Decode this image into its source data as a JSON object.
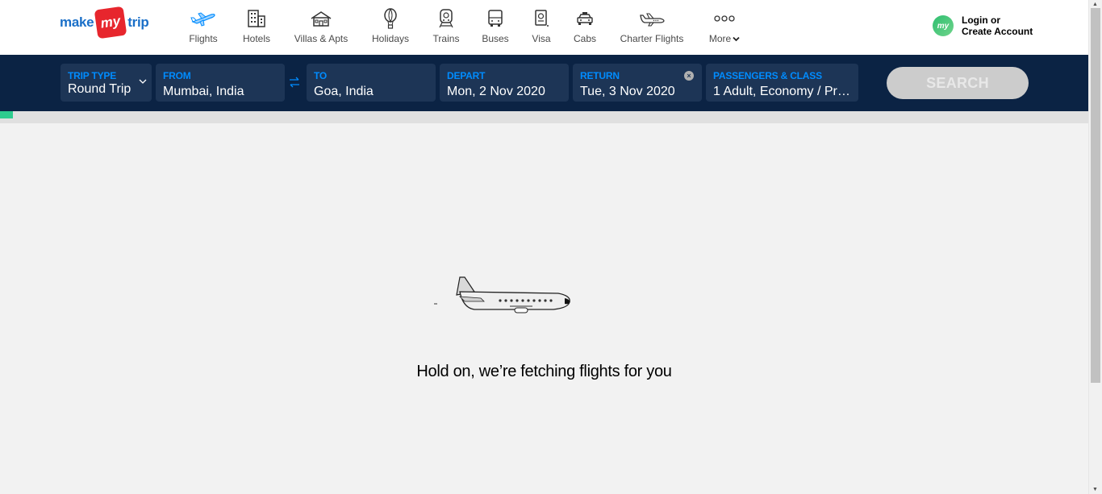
{
  "brand": {
    "make": "make",
    "my": "my",
    "trip": "trip"
  },
  "nav": [
    {
      "label": "Flights",
      "icon": "flight-icon"
    },
    {
      "label": "Hotels",
      "icon": "hotel-icon"
    },
    {
      "label": "Villas & Apts",
      "icon": "villa-icon"
    },
    {
      "label": "Holidays",
      "icon": "holiday-balloon-icon"
    },
    {
      "label": "Trains",
      "icon": "train-icon"
    },
    {
      "label": "Buses",
      "icon": "bus-icon"
    },
    {
      "label": "Visa",
      "icon": "visa-icon"
    },
    {
      "label": "Cabs",
      "icon": "cab-icon"
    },
    {
      "label": "Charter Flights",
      "icon": "charter-plane-icon"
    },
    {
      "label": "More",
      "icon": "more-dots-icon"
    }
  ],
  "account": {
    "avatar": "my",
    "line1": "Login or",
    "line2": "Create Account"
  },
  "search": {
    "trip_type": {
      "label": "TRIP TYPE",
      "value": "Round Trip"
    },
    "from": {
      "label": "FROM",
      "value": "Mumbai, India"
    },
    "to": {
      "label": "TO",
      "value": "Goa, India"
    },
    "depart": {
      "label": "DEPART",
      "value": "Mon, 2 Nov 2020"
    },
    "return": {
      "label": "RETURN",
      "value": "Tue, 3 Nov 2020"
    },
    "passengers": {
      "label": "PASSENGERS & CLASS",
      "value": "1 Adult, Economy / Pre..."
    },
    "button": "SEARCH"
  },
  "loading": {
    "message": "Hold on, we’re fetching flights for you"
  },
  "colors": {
    "accent": "#008cff",
    "navy": "#0b2344",
    "field": "#1d3556",
    "brand_red": "#e7262d",
    "progress": "#2ecc8f"
  }
}
